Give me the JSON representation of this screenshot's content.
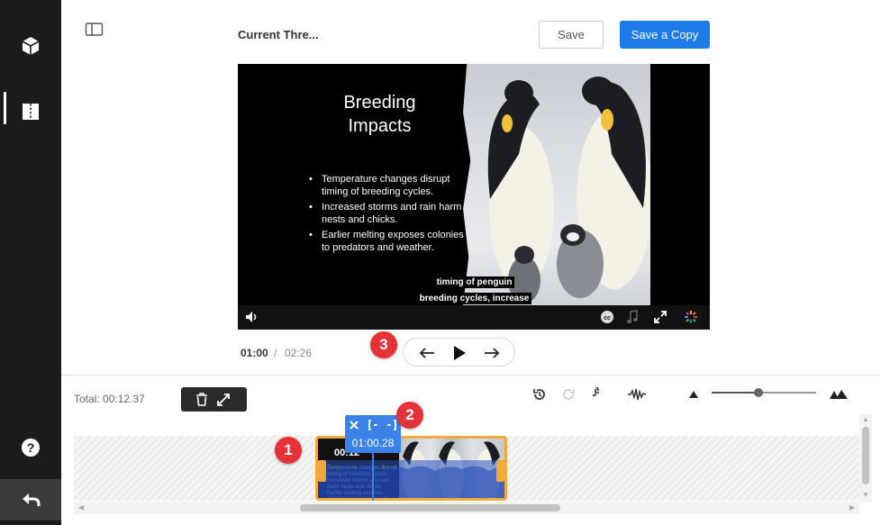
{
  "sidebar": {
    "items": [
      {
        "icon": "cube-icon",
        "active": false
      },
      {
        "icon": "book-icon",
        "active": true
      }
    ],
    "help_icon": "help-icon",
    "undo_icon": "back-icon"
  },
  "header": {
    "title": "Current Thre...",
    "save_label": "Save",
    "save_copy_label": "Save a Copy",
    "accent_color": "#1e7ce8"
  },
  "video": {
    "slide_title_line1": "Breeding",
    "slide_title_line2": "Impacts",
    "bullets": [
      "Temperature changes disrupt timing of breeding cycles.",
      "Increased storms and rain harm nests and chicks.",
      "Earlier melting exposes colonies to predators and weather."
    ],
    "caption_line1": "timing of penguin",
    "caption_line2": "breeding cycles, increase"
  },
  "playback": {
    "current_time": "01:00",
    "separator": "/",
    "total_time": "02:26"
  },
  "callouts": {
    "one": "1",
    "two": "2",
    "three": "3"
  },
  "timeline": {
    "total_label": "Total: 00:12.37",
    "clip_time": "00:12",
    "clip_text": "Temperature changes disrupt timing of breeding cycles. Increased storms and rain harm nests and chicks. Earlier melting exposes colonies to predators and",
    "playhead_time": "01:00.28",
    "zoom_level": 0.45,
    "clip_color": "#f0a93a",
    "playhead_color": "#3b82e8"
  }
}
